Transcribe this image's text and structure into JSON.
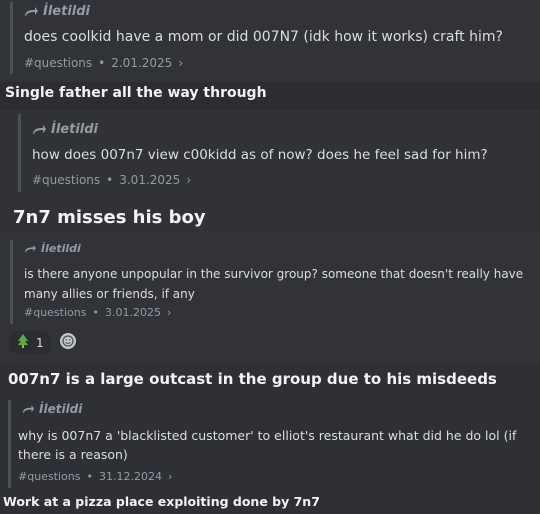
{
  "messages": [
    {
      "forwarded_label": "İletildi",
      "question": "does coolkid have a mom or did 007N7 (idk how it works) craft him?",
      "channel": "#questions",
      "date": "2.01.2025",
      "reply": "Single father all the way through"
    },
    {
      "forwarded_label": "İletildi",
      "question": "how does 007n7 view c00kidd as of now? does he feel sad for him?",
      "channel": "#questions",
      "date": "3.01.2025",
      "reply": "7n7 misses his boy"
    },
    {
      "forwarded_label": "İletildi",
      "question": "is there anyone unpopular in the survivor group? someone that doesn't really have many allies or friends, if any",
      "channel": "#questions",
      "date": "3.01.2025",
      "reaction_count": "1",
      "reply": "007n7 is a large outcast in the group due to his misdeeds"
    },
    {
      "forwarded_label": "İletildi",
      "question": "why is 007n7 a 'blacklisted customer' to elliot's restaurant what did he do lol (if there is a reason)",
      "channel": "#questions",
      "date": "31.12.2024",
      "reply": "Work at a pizza place exploiting done by 7n7"
    }
  ],
  "colors": {
    "background": "#313338",
    "muted": "#949ba4",
    "text": "#dbdee1",
    "bar": "#4e5058"
  }
}
